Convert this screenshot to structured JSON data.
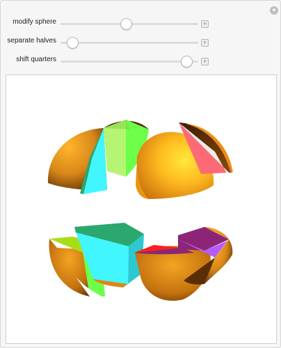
{
  "controls": {
    "corner_button_symbol": "+",
    "sliders": [
      {
        "label": "modify sphere",
        "value": 0.47,
        "expand_symbol": "+"
      },
      {
        "label": "separate halves",
        "value": 0.05,
        "expand_symbol": "+"
      },
      {
        "label": "shift quarters",
        "value": 0.95,
        "expand_symbol": "+"
      }
    ]
  },
  "graphic": {
    "description_icon": "3d-split-sphere-graphic",
    "colors": {
      "shell_outer": "#d9881a",
      "shell_dark": "#5a2e05",
      "shell_highlight": "#ffe83a",
      "cut_cyan": "#41f6ff",
      "cut_green": "#6dff4a",
      "cut_lightgreen": "#b6f574",
      "cut_pink": "#fc6a76",
      "cut_purple": "#b35cff",
      "cut_magenta": "#8c2578",
      "cut_red": "#ff1e1e",
      "cut_teal": "#2aa86e",
      "cut_olive": "#a8dd1a"
    }
  }
}
